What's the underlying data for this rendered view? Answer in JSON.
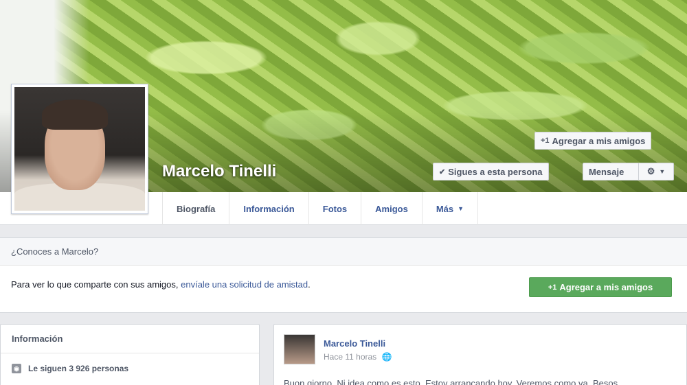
{
  "profile": {
    "name": "Marcelo Tinelli"
  },
  "cover_buttons": {
    "add_friend": "Agregar a mis amigos",
    "following": "Sigues a esta persona",
    "message": "Mensaje"
  },
  "tabs": [
    {
      "label": "Biografía"
    },
    {
      "label": "Información"
    },
    {
      "label": "Fotos"
    },
    {
      "label": "Amigos"
    },
    {
      "label": "Más"
    }
  ],
  "know_box": {
    "title": "¿Conoces a Marcelo?",
    "text": "Para ver lo que comparte con sus amigos, ",
    "link": "envíale una solicitud de amistad",
    "end": ".",
    "button": "Agregar a mis amigos"
  },
  "info_box": {
    "title": "Información",
    "followers": "Le siguen 3 926 personas"
  },
  "post": {
    "author": "Marcelo Tinelli",
    "time": "Hace 11 horas",
    "text": "Buon giorno. Ni idea como es esto. Estoy arrancando hoy. Veremos como va. Besos"
  },
  "colors": {
    "link": "#3b5998",
    "green_button": "#5aa95c"
  }
}
